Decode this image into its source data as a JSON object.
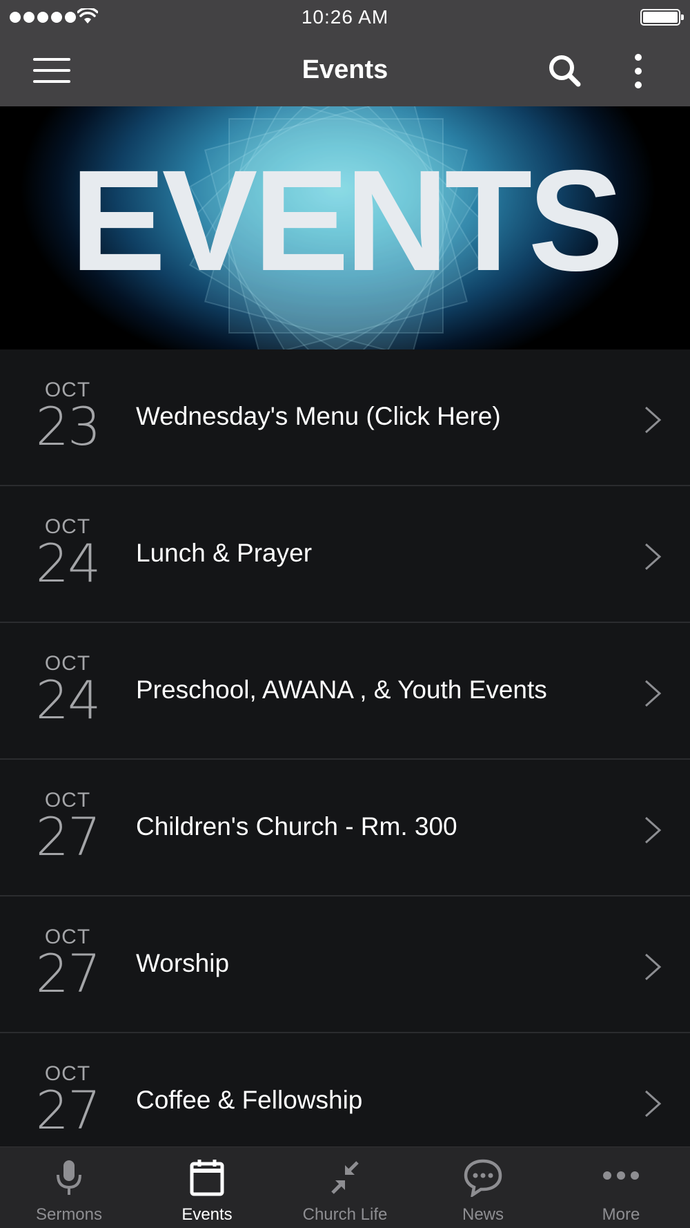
{
  "status_bar": {
    "time": "10:26 AM"
  },
  "nav": {
    "title": "Events"
  },
  "banner": {
    "text": "EVENTS"
  },
  "events": [
    {
      "month": "OCT",
      "day": "23",
      "title": "Wednesday's Menu (Click Here)"
    },
    {
      "month": "OCT",
      "day": "24",
      "title": "Lunch & Prayer"
    },
    {
      "month": "OCT",
      "day": "24",
      "title": "Preschool, AWANA , & Youth Events"
    },
    {
      "month": "OCT",
      "day": "27",
      "title": "Children's Church - Rm. 300"
    },
    {
      "month": "OCT",
      "day": "27",
      "title": "Worship"
    },
    {
      "month": "OCT",
      "day": "27",
      "title": "Coffee & Fellowship"
    }
  ],
  "tabs": [
    {
      "label": "Sermons",
      "icon": "microphone-icon"
    },
    {
      "label": "Events",
      "icon": "calendar-icon",
      "active": true
    },
    {
      "label": "Church Life",
      "icon": "compress-arrows-icon"
    },
    {
      "label": "News",
      "icon": "chat-bubble-icon"
    },
    {
      "label": "More",
      "icon": "more-dots-icon"
    }
  ],
  "colors": {
    "bar_background": "#434244",
    "list_background": "#141517",
    "tab_background": "#262628",
    "inactive_tab": "#8e8e92",
    "active_tab": "#ffffff"
  }
}
